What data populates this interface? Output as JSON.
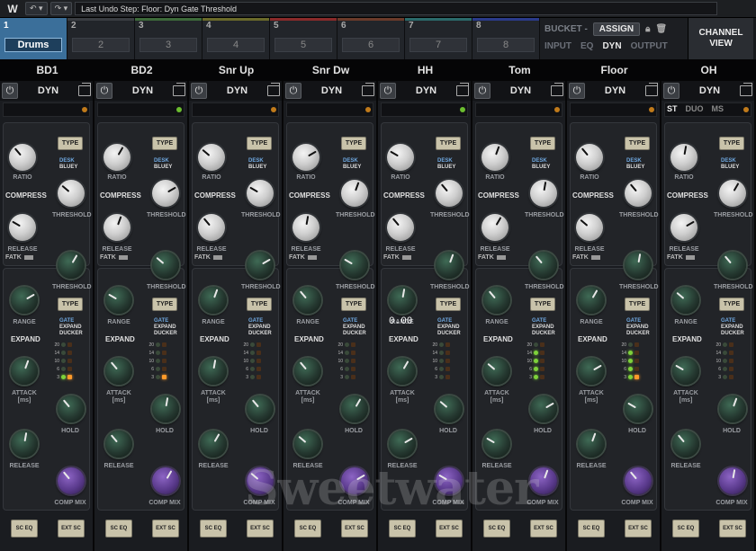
{
  "toolbar": {
    "undo_label": "Last Undo Step:  Floor: Dyn Gate Threshold",
    "logo": "W"
  },
  "groups": [
    {
      "num": "1",
      "name": "Drums",
      "active": true,
      "color": "#3b6f9a"
    },
    {
      "num": "2",
      "name": "2",
      "color": "#3a3d42"
    },
    {
      "num": "3",
      "name": "3",
      "color": "#3d6a3a"
    },
    {
      "num": "4",
      "name": "4",
      "color": "#6a6a2a"
    },
    {
      "num": "5",
      "name": "5",
      "color": "#8a2a2a"
    },
    {
      "num": "6",
      "name": "6",
      "color": "#6a3a2a"
    },
    {
      "num": "7",
      "name": "7",
      "color": "#2a6a6a"
    },
    {
      "num": "8",
      "name": "8",
      "color": "#2a3a8a"
    }
  ],
  "right_tools": {
    "bucket": "BUCKET -",
    "assign": "ASSIGN",
    "input": "INPUT",
    "eq": "EQ",
    "dyn": "DYN",
    "output": "OUTPUT"
  },
  "channel_view": "CHANNEL VIEW",
  "channels": [
    {
      "name": "BD1",
      "led": "o"
    },
    {
      "name": "BD2",
      "led": "g"
    },
    {
      "name": "Snr Up",
      "led": "o"
    },
    {
      "name": "Snr Dw",
      "led": "o"
    },
    {
      "name": "HH",
      "led": "g"
    },
    {
      "name": "Tom",
      "led": "o"
    },
    {
      "name": "Floor",
      "led": "o"
    },
    {
      "name": "OH",
      "led": "o",
      "stereo": true
    }
  ],
  "labels": {
    "dyn": "DYN",
    "power": "⏻",
    "ratio": "RATIO",
    "compress": "COMPRESS",
    "threshold": "THRESHOLD",
    "release": "RELEASE",
    "fatk": "FATK",
    "type": "TYPE",
    "desk": "DESK",
    "bluey": "BLUEY",
    "range": "RANGE",
    "expand": "EXPAND",
    "gate": "GATE",
    "expand_s": "EXPAND",
    "ducker": "DUCKER",
    "attack": "ATTACK",
    "ms": "[ms]",
    "hold": "HOLD",
    "comp_mix": "COMP MIX",
    "sc_eq": "SC EQ",
    "ext_sc": "EXT SC",
    "st": "ST",
    "duo": "DUO",
    "mst": "MS",
    "readout": "0.00",
    "meter": [
      "20",
      "14",
      "10",
      "6",
      "3"
    ]
  },
  "watermark": "Sweetwater"
}
